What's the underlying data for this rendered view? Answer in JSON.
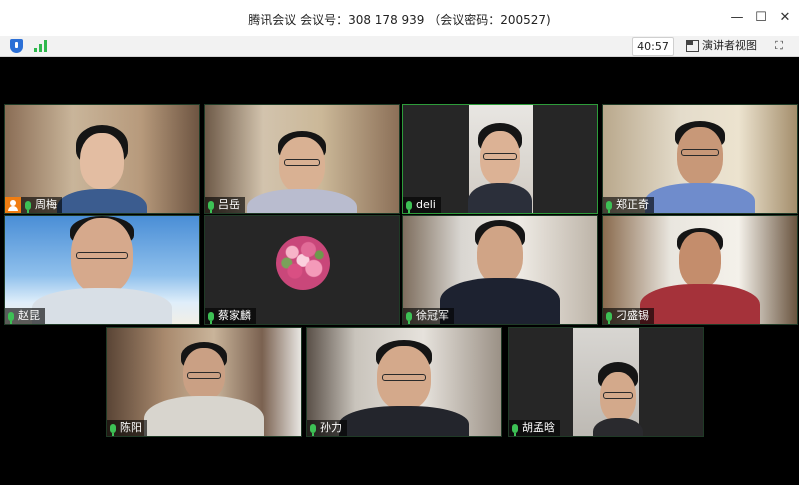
{
  "window": {
    "title": "腾讯会议 会议号：308 178 939 （会议密码：200527)",
    "minimize": "—",
    "maximize": "☐",
    "close": "✕"
  },
  "toolbar": {
    "timer": "40:57",
    "speaker_view": "演讲者视图",
    "fullscreen": "⛶",
    "accent": "#2fb84d"
  },
  "participants": [
    {
      "name": "周梅",
      "host": true
    },
    {
      "name": "吕岳"
    },
    {
      "name": "deli"
    },
    {
      "name": "郑正奇"
    },
    {
      "name": "赵昆"
    },
    {
      "name": "蔡家麟"
    },
    {
      "name": "徐冠军"
    },
    {
      "name": "刁盛锡"
    },
    {
      "name": "陈阳"
    },
    {
      "name": "孙力"
    },
    {
      "name": "胡孟晗"
    }
  ]
}
